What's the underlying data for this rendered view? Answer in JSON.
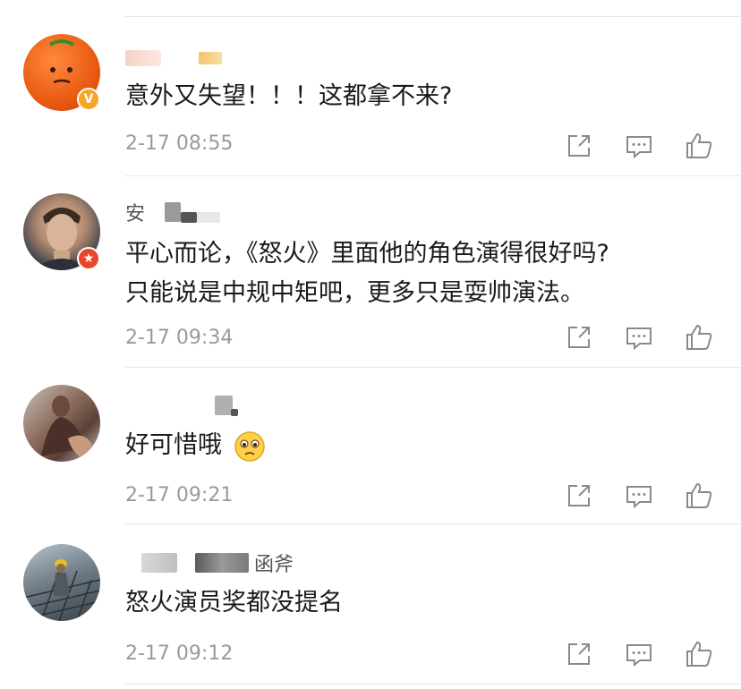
{
  "comments": [
    {
      "name_suffix": "",
      "text_lines": [
        "意外又失望！！！这都拿不来?"
      ],
      "time": "2-17 08:55",
      "badge": "V"
    },
    {
      "name_suffix": "安",
      "text_lines": [
        "平心而论，《怒火》里面他的角色演得很好吗?",
        "只能说是中规中矩吧，更多只是耍帅演法。"
      ],
      "time": "2-17 09:34",
      "badge": "★"
    },
    {
      "name_suffix": "",
      "text_lines": [
        "好可惜哦"
      ],
      "time": "2-17 09:21",
      "badge": ""
    },
    {
      "name_suffix": "函斧",
      "text_lines": [
        "怒火演员奖都没提名"
      ],
      "time": "2-17 09:12",
      "badge": ""
    }
  ],
  "icons": {
    "share": "share-icon",
    "comment": "comment-icon",
    "like": "like-icon"
  },
  "colors": {
    "time": "#9a9a9a",
    "icon": "#8a8a8a",
    "badge_v": "#f5a623",
    "badge_star": "#e8462a"
  }
}
